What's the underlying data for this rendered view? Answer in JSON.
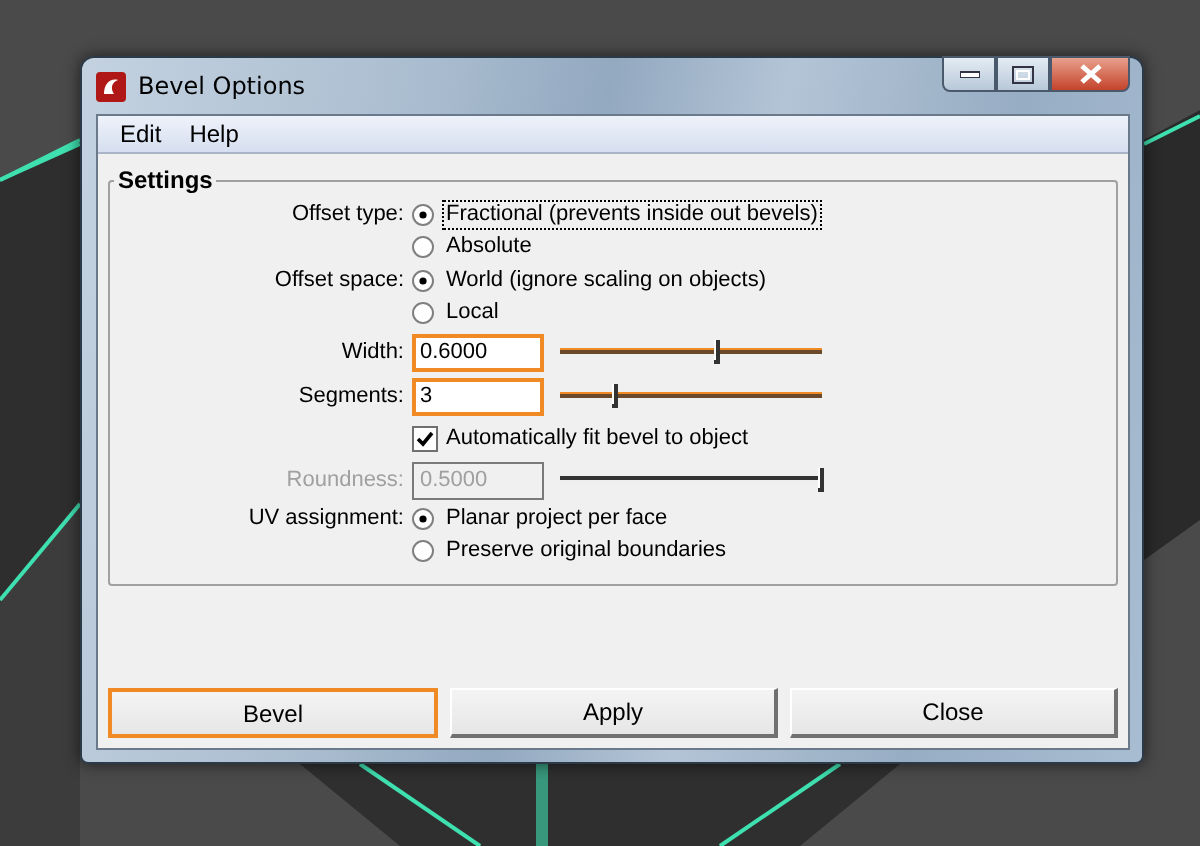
{
  "window": {
    "title": "Bevel Options"
  },
  "menu": [
    "Edit",
    "Help"
  ],
  "settings": {
    "title": "Settings",
    "rows": [
      {
        "kind": "radio",
        "label": "Offset type:",
        "options": [
          {
            "label": "Fractional (prevents inside out bevels)",
            "selected": true,
            "focused": true
          },
          {
            "label": "Absolute",
            "selected": false,
            "focused": false
          }
        ]
      },
      {
        "kind": "radio",
        "label": "Offset space:",
        "options": [
          {
            "label": "World (ignore scaling on objects)",
            "selected": true,
            "focused": false
          },
          {
            "label": "Local",
            "selected": false,
            "focused": false
          }
        ]
      },
      {
        "kind": "slider",
        "label": "Width:",
        "value": "0.6000",
        "level": 0.6,
        "highlighted": true,
        "disabled": false
      },
      {
        "kind": "slider",
        "label": "Segments:",
        "value": "3",
        "level": 0.21,
        "highlighted": true,
        "disabled": false
      },
      {
        "kind": "checkbox",
        "label": "Automatically fit bevel to object",
        "checked": true
      },
      {
        "kind": "slider",
        "label": "Roundness:",
        "value": "0.5000",
        "level": 1,
        "highlighted": false,
        "disabled": true
      },
      {
        "kind": "radio",
        "label": "UV assignment:",
        "options": [
          {
            "label": "Planar project per face",
            "selected": true,
            "focused": false
          },
          {
            "label": "Preserve original boundaries",
            "selected": false,
            "focused": false
          }
        ]
      }
    ]
  },
  "buttons": [
    {
      "label": "Bevel",
      "highlighted": true
    },
    {
      "label": "Apply",
      "highlighted": false
    },
    {
      "label": "Close",
      "highlighted": false
    }
  ]
}
